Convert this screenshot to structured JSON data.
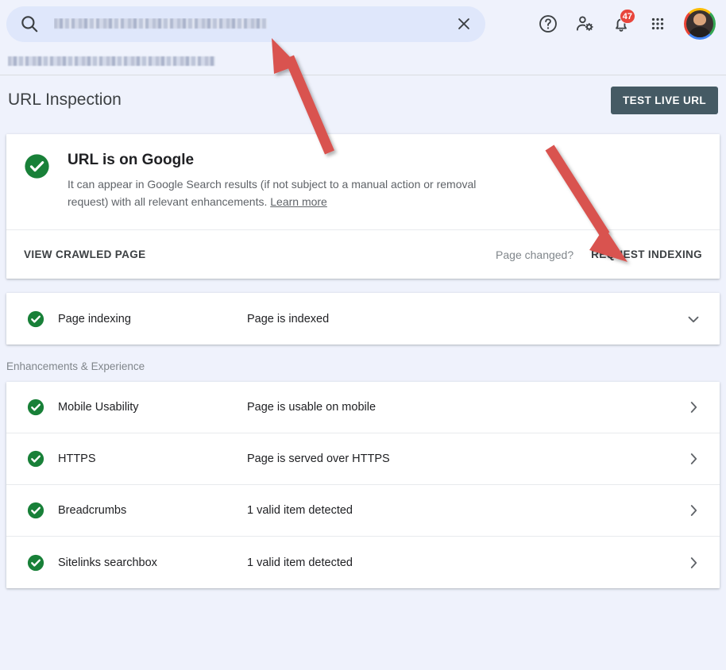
{
  "topbar": {
    "search": {
      "icon": "search-icon",
      "value_redacted": true,
      "clear_icon": "close-icon"
    },
    "help_icon": "help-circle-icon",
    "account_settings_icon": "person-gear-icon",
    "notifications_icon": "bell-icon",
    "notifications_count": "47",
    "apps_icon": "grid-apps-icon",
    "avatar_icon": "avatar"
  },
  "property_url_redacted": true,
  "header": {
    "title": "URL Inspection",
    "test_live_url_label": "TEST LIVE URL"
  },
  "status_card": {
    "icon": "check-circle-icon",
    "title": "URL is on Google",
    "description": "It can appear in Google Search results (if not subject to a manual action or removal request) with all relevant enhancements.",
    "learn_more_label": "Learn more",
    "view_crawled_page_label": "VIEW CRAWLED PAGE",
    "page_changed_label": "Page changed?",
    "request_indexing_label": "REQUEST INDEXING"
  },
  "indexing_card": {
    "icon": "check-circle-icon",
    "label": "Page indexing",
    "value": "Page is indexed",
    "expand_icon": "chevron-down-icon"
  },
  "enhancements": {
    "section_label": "Enhancements & Experience",
    "rows": [
      {
        "icon": "check-circle-icon",
        "label": "Mobile Usability",
        "value": "Page is usable on mobile",
        "chevron": "chevron-right-icon"
      },
      {
        "icon": "check-circle-icon",
        "label": "HTTPS",
        "value": "Page is served over HTTPS",
        "chevron": "chevron-right-icon"
      },
      {
        "icon": "check-circle-icon",
        "label": "Breadcrumbs",
        "value": "1 valid item detected",
        "chevron": "chevron-right-icon"
      },
      {
        "icon": "check-circle-icon",
        "label": "Sitelinks searchbox",
        "value": "1 valid item detected",
        "chevron": "chevron-right-icon"
      }
    ]
  },
  "annotations": [
    {
      "name": "arrow-to-search-field",
      "color": "#d9534f"
    },
    {
      "name": "arrow-to-request-indexing",
      "color": "#d9534f"
    }
  ],
  "colors": {
    "page_background": "#eff2fc",
    "search_background": "#dfe7fb",
    "success_green": "#188038",
    "button_slate": "#455a64",
    "badge_red": "#e8453c",
    "annotation_red": "#d9534f"
  }
}
